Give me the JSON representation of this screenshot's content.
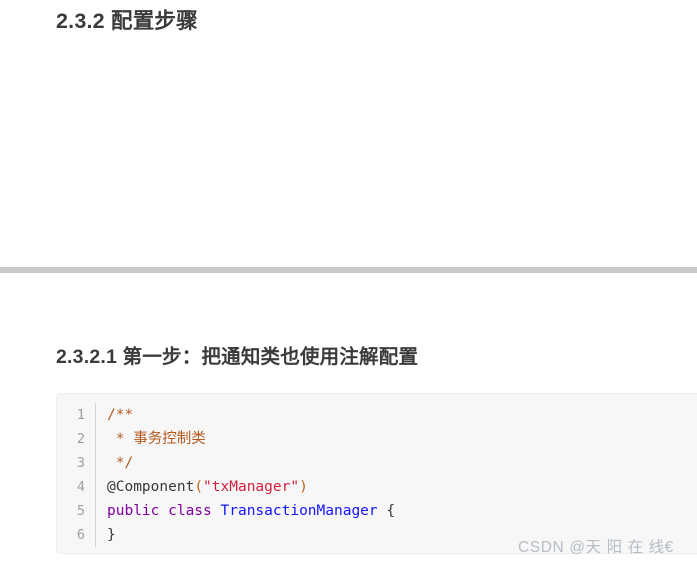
{
  "document": {
    "section_heading": "2.3.2 配置步骤",
    "subsection_heading": "2.3.2.1 第一步：把通知类也使用注解配置"
  },
  "divider": {
    "color": "#c9c9c9"
  },
  "code_block": {
    "background": "#f7f7f8",
    "language": "java",
    "line_numbers": [
      "1",
      "2",
      "3",
      "4",
      "5",
      "6"
    ],
    "lines": [
      {
        "number": "1",
        "text": "/**"
      },
      {
        "number": "2",
        "text": " * 事务控制类"
      },
      {
        "number": "3",
        "text": " */"
      },
      {
        "number": "4",
        "text": "@Component(\"txManager\")"
      },
      {
        "number": "5",
        "text": "public class TransactionManager {"
      },
      {
        "number": "6",
        "text": "}"
      }
    ],
    "tokens": {
      "l1_comment": "/**",
      "l2_comment": " * 事务控制类",
      "l3_comment": " */",
      "l4_annotation": "@Component",
      "l4_open_paren": "(",
      "l4_string": "\"txManager\"",
      "l4_close_paren": ")",
      "l5_keyword": "public class ",
      "l5_type": "TransactionManager",
      "l5_brace": " {",
      "l6_brace": "}"
    },
    "colors": {
      "comment": "#b35a1f",
      "keyword": "#8000a0",
      "type": "#1414ff",
      "string": "#d01f3c",
      "paren": "#c9661c",
      "plain": "#383838",
      "line_number": "#9aa0a6"
    }
  },
  "watermark": {
    "text": "CSDN @天 阳 在 线€"
  }
}
